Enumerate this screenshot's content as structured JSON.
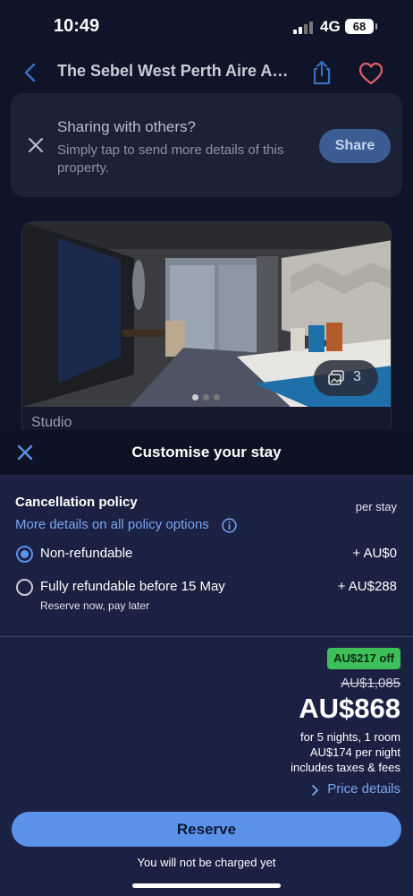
{
  "status_bar": {
    "time": "10:49",
    "network": "4G",
    "battery": "68"
  },
  "header": {
    "title": "The Sebel West Perth Aire Apar...",
    "icons": {
      "back": "chevron-left-icon",
      "share": "share-icon",
      "favorite": "heart-icon"
    }
  },
  "share_prompt": {
    "title": "Sharing with others?",
    "body": "Simply tap to send more details of this property.",
    "button_label": "Share"
  },
  "room": {
    "name": "Studio",
    "photo_count": "3",
    "photo_pages": 3,
    "active_photo_index": 0
  },
  "customise": {
    "title": "Customise your stay",
    "cancellation_title": "Cancellation policy",
    "per_stay_label": "per stay",
    "more_details_link": "More details on all policy options",
    "options": [
      {
        "label": "Non-refundable",
        "price": "+ AU$0",
        "sub": "",
        "selected": true
      },
      {
        "label": "Fully refundable before 15 May",
        "price": "+ AU$288",
        "sub": "Reserve now, pay later",
        "selected": false
      }
    ]
  },
  "pricing": {
    "discount_badge": "AU$217 off",
    "old_price": "AU$1,085",
    "total_price": "AU$868",
    "stay_summary": "for 5 nights, 1 room",
    "nightly": "AU$174 per night",
    "taxes_note": "includes taxes & fees",
    "price_details_link": "Price details",
    "reserve_label": "Reserve",
    "not_charged_note": "You will not be charged yet"
  },
  "colors": {
    "background": "#0f1428",
    "panel": "#1b2142",
    "accent_blue": "#5b93ea",
    "link_blue": "#78a6f0",
    "discount_green": "#3fbf5a",
    "favorite_red": "#e0606a"
  }
}
